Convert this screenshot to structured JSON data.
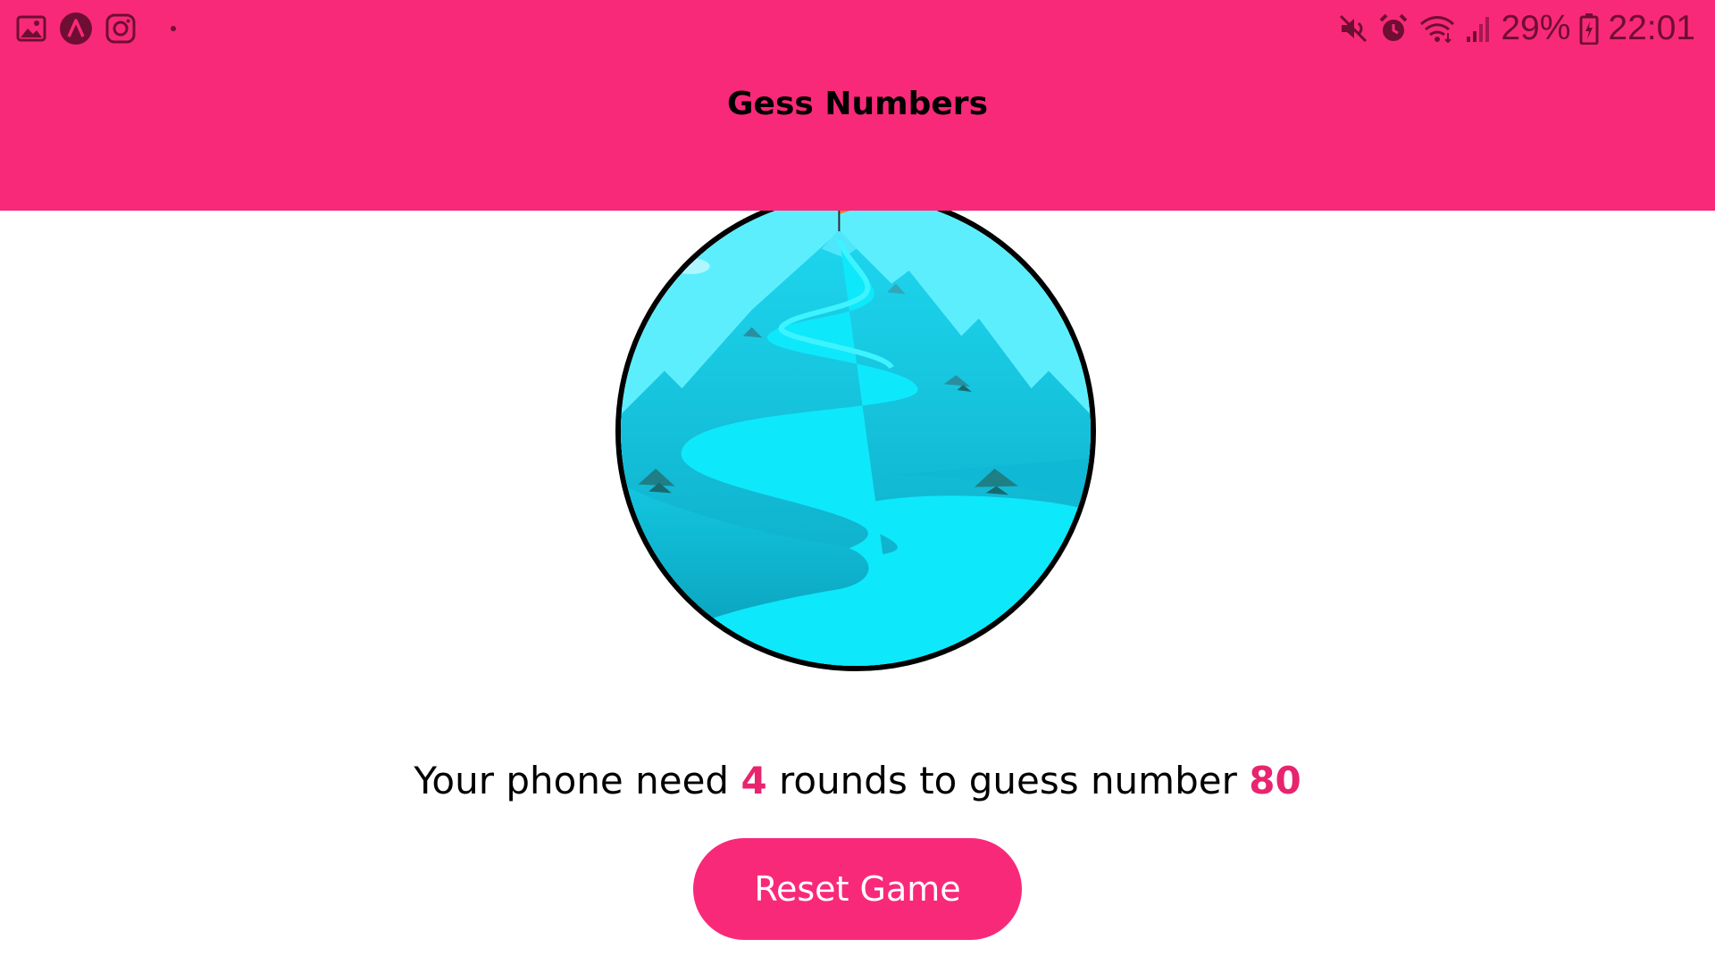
{
  "status_bar": {
    "left_icons": [
      "gallery-icon",
      "app-a-icon",
      "instagram-icon",
      "dot-icon"
    ],
    "right_icons": [
      "mute-icon",
      "alarm-icon",
      "wifi-icon",
      "signal-icon",
      "battery-icon"
    ],
    "battery_percent": "29%",
    "time": "22:01"
  },
  "header": {
    "title": "Gess Numbers"
  },
  "result": {
    "prefix": "Your phone need ",
    "rounds": "4",
    "middle": " rounds to guess number ",
    "number": "80"
  },
  "actions": {
    "reset_label": "Reset Game"
  },
  "colors": {
    "primary": "#f9297a",
    "highlight": "#e8246f",
    "status_icons": "#6e0e32"
  }
}
